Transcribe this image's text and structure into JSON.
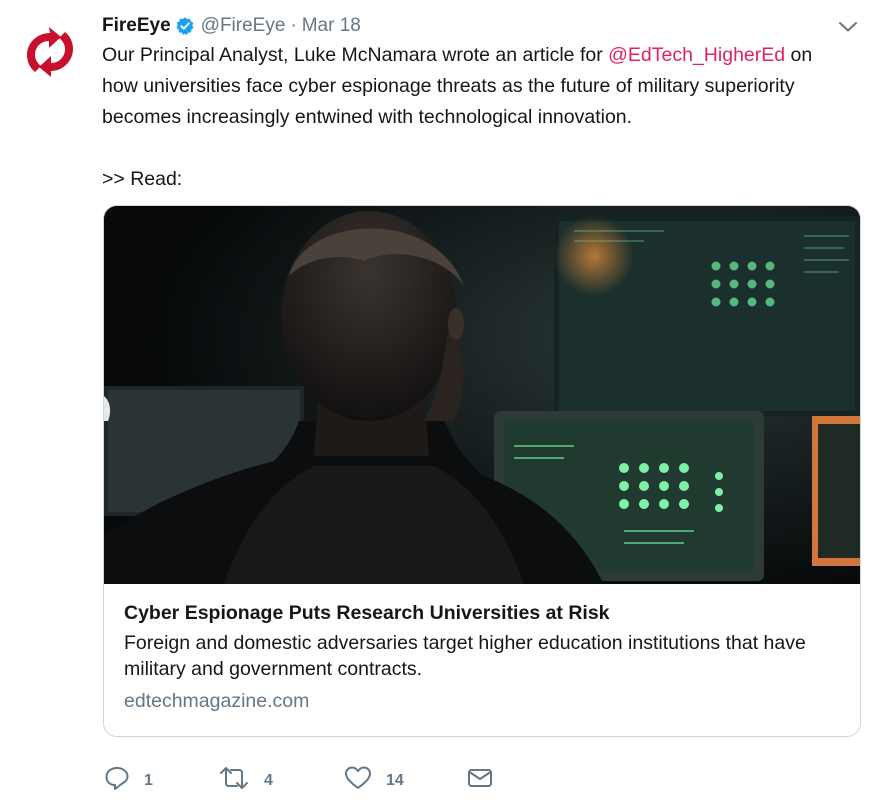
{
  "author": {
    "display_name": "FireEye",
    "handle": "@FireEye",
    "separator": "·",
    "timestamp": "Mar 18",
    "verified": true,
    "avatar_icon": "fireeye-logo-icon"
  },
  "tweet": {
    "text_before_mention": "Our Principal Analyst, Luke McNamara wrote an article for ",
    "mention": "@EdTech_HigherEd",
    "text_after_mention": " on how universities face cyber espionage threats as the future of military superiority becomes increasingly entwined with technological innovation.",
    "read_line": ">> Read:"
  },
  "card": {
    "image_description_icon": "hacker-at-computers-photo",
    "title": "Cyber Espionage Puts Research Universities at Risk",
    "description": "Foreign and domestic adversaries target higher education institutions that have military and government contracts.",
    "domain": "edtechmagazine.com"
  },
  "actions": {
    "reply": {
      "icon": "reply-icon",
      "count": "1"
    },
    "retweet": {
      "icon": "retweet-icon",
      "count": "4"
    },
    "like": {
      "icon": "heart-icon",
      "count": "14"
    },
    "dm": {
      "icon": "envelope-icon"
    }
  },
  "colors": {
    "mention": "#e0245e",
    "secondary_text": "#657786",
    "verified_badge": "#1da1f2",
    "logo_red": "#c8102e",
    "card_border": "#ccd6dd"
  }
}
